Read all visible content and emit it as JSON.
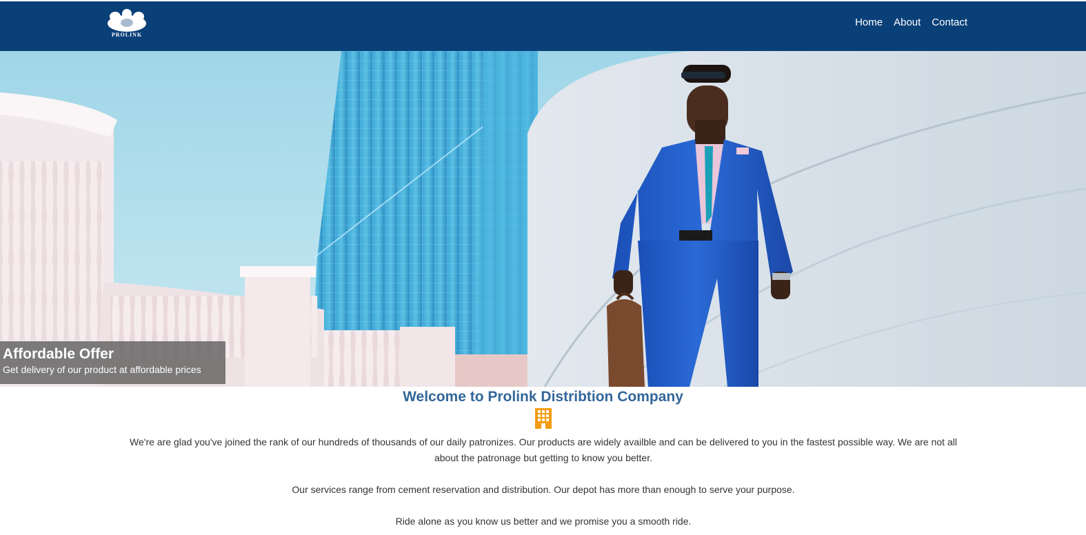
{
  "brand": {
    "logo_text": "PROLINK"
  },
  "nav": {
    "items": [
      {
        "label": "Home"
      },
      {
        "label": "About"
      },
      {
        "label": "Contact"
      }
    ]
  },
  "hero": {
    "caption_title": "Affordable Offer",
    "caption_subtitle": "Get delivery of our product at affordable prices"
  },
  "main": {
    "welcome_title": "Welcome to Prolink Distribtion Company",
    "icon": "building-icon",
    "paragraphs": [
      "We're are glad you've joined the rank of our hundreds of thousands of our daily patronizes. Our products are widely availble and can be delivered to you in the fastest possible way. We are not all about the patronage but getting to know you better.",
      "Our services range from cement reservation and distribution. Our depot has more than enough to serve your purpose.",
      "Ride alone as you know us better and we promise you a smooth ride."
    ]
  },
  "colors": {
    "navbar": "#0a4078",
    "welcome_title": "#336699",
    "accent_icon": "#f39c12"
  }
}
